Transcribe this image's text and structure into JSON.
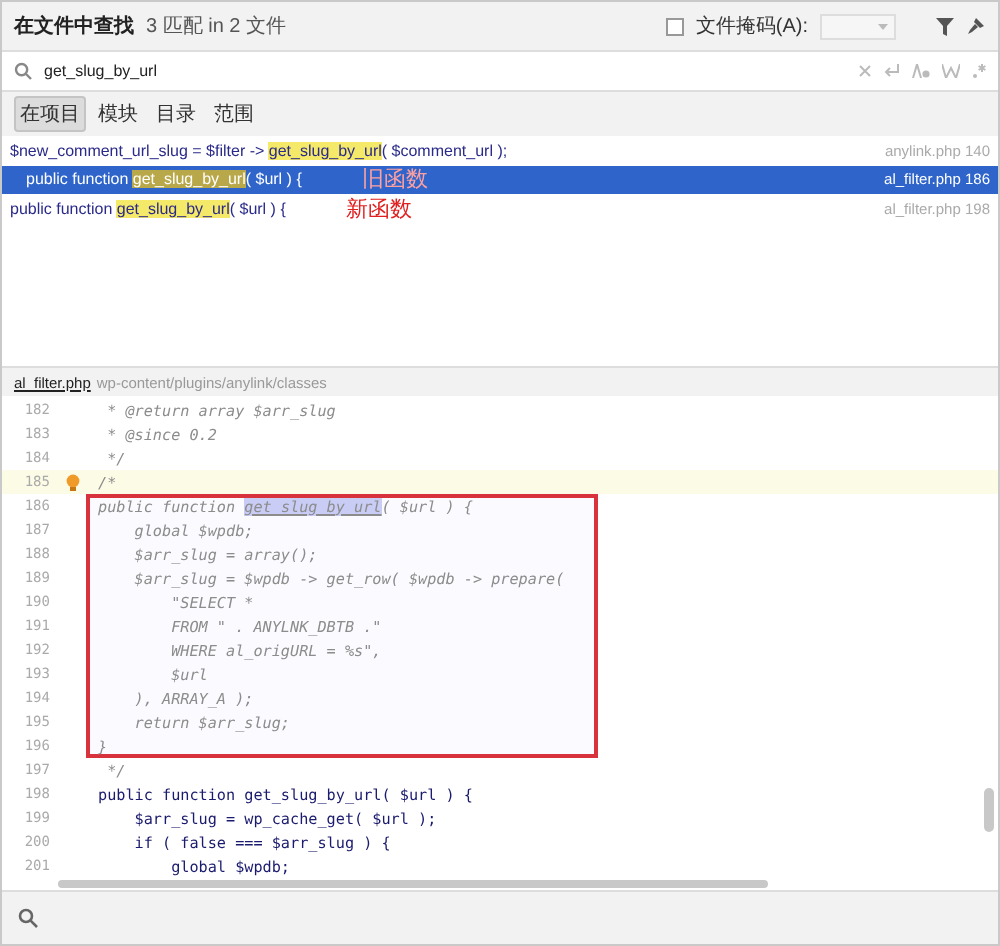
{
  "header": {
    "title": "在文件中查找",
    "summary": "3 匹配 in 2 文件",
    "file_mask": {
      "label": "文件掩码(A):",
      "checked": false
    }
  },
  "search": {
    "value": "get_slug_by_url"
  },
  "scopes": [
    {
      "label": "在项目",
      "selected": true
    },
    {
      "label": "模块",
      "selected": false
    },
    {
      "label": "目录",
      "selected": false
    },
    {
      "label": "范围",
      "selected": false
    }
  ],
  "results": [
    {
      "before": "$new_comment_url_slug = $filter -> ",
      "match": "get_slug_by_url",
      "after": "( $comment_url );",
      "file": "anylink.php 140",
      "selected": false
    },
    {
      "before": "public function ",
      "match": "get_slug_by_url",
      "after": "( $url ) {",
      "file": "al_filter.php 186",
      "selected": true,
      "note": "旧函数"
    },
    {
      "before": "public function ",
      "match": "get_slug_by_url",
      "after": "( $url ) {",
      "file": "al_filter.php 198",
      "selected": false,
      "note": "新函数"
    }
  ],
  "editor": {
    "file": "al_filter.php",
    "dir": "wp-content/plugins/anylink/classes",
    "lines": [
      {
        "number": "182",
        "kind": "comment",
        "text": " * @return array $arr_slug",
        "current": false,
        "boxed": false
      },
      {
        "number": "183",
        "kind": "comment",
        "text": " * @since 0.2",
        "current": false,
        "boxed": false
      },
      {
        "number": "184",
        "kind": "comment",
        "text": " */",
        "current": false,
        "boxed": false
      },
      {
        "number": "185",
        "kind": "comment",
        "text": "/*",
        "current": true,
        "boxed": false
      },
      {
        "number": "186",
        "kind": "comment",
        "text": "public function ",
        "match": "get_slug_by_url",
        "after": "( $url ) {",
        "current": false,
        "boxed": true
      },
      {
        "number": "187",
        "kind": "comment",
        "text": "    global $wpdb;",
        "current": false,
        "boxed": true
      },
      {
        "number": "188",
        "kind": "comment",
        "text": "    $arr_slug = array();",
        "current": false,
        "boxed": true
      },
      {
        "number": "189",
        "kind": "comment",
        "text": "    $arr_slug = $wpdb -> get_row( $wpdb -> prepare(",
        "current": false,
        "boxed": true
      },
      {
        "number": "190",
        "kind": "comment",
        "text": "        \"SELECT *",
        "current": false,
        "boxed": true
      },
      {
        "number": "191",
        "kind": "comment",
        "text": "        FROM \" . ANYLNK_DBTB .\"",
        "current": false,
        "boxed": true
      },
      {
        "number": "192",
        "kind": "comment",
        "text": "        WHERE al_origURL = %s\",",
        "current": false,
        "boxed": true
      },
      {
        "number": "193",
        "kind": "comment",
        "text": "        $url",
        "current": false,
        "boxed": true
      },
      {
        "number": "194",
        "kind": "comment",
        "text": "    ), ARRAY_A );",
        "current": false,
        "boxed": true
      },
      {
        "number": "195",
        "kind": "comment",
        "text": "    return $arr_slug;",
        "current": false,
        "boxed": true
      },
      {
        "number": "196",
        "kind": "comment",
        "text": "}",
        "current": false,
        "boxed": true
      },
      {
        "number": "197",
        "kind": "comment",
        "text": " */",
        "current": false,
        "boxed": false
      },
      {
        "number": "198",
        "kind": "code",
        "text": "public function get_slug_by_url( $url ) {",
        "current": false,
        "boxed": false
      },
      {
        "number": "199",
        "kind": "code",
        "text": "    $arr_slug = wp_cache_get( $url );",
        "current": false,
        "boxed": false
      },
      {
        "number": "200",
        "kind": "code",
        "text": "    if ( false === $arr_slug ) {",
        "current": false,
        "boxed": false
      },
      {
        "number": "201",
        "kind": "code",
        "text": "        global $wpdb;",
        "current": false,
        "boxed": false
      }
    ]
  }
}
